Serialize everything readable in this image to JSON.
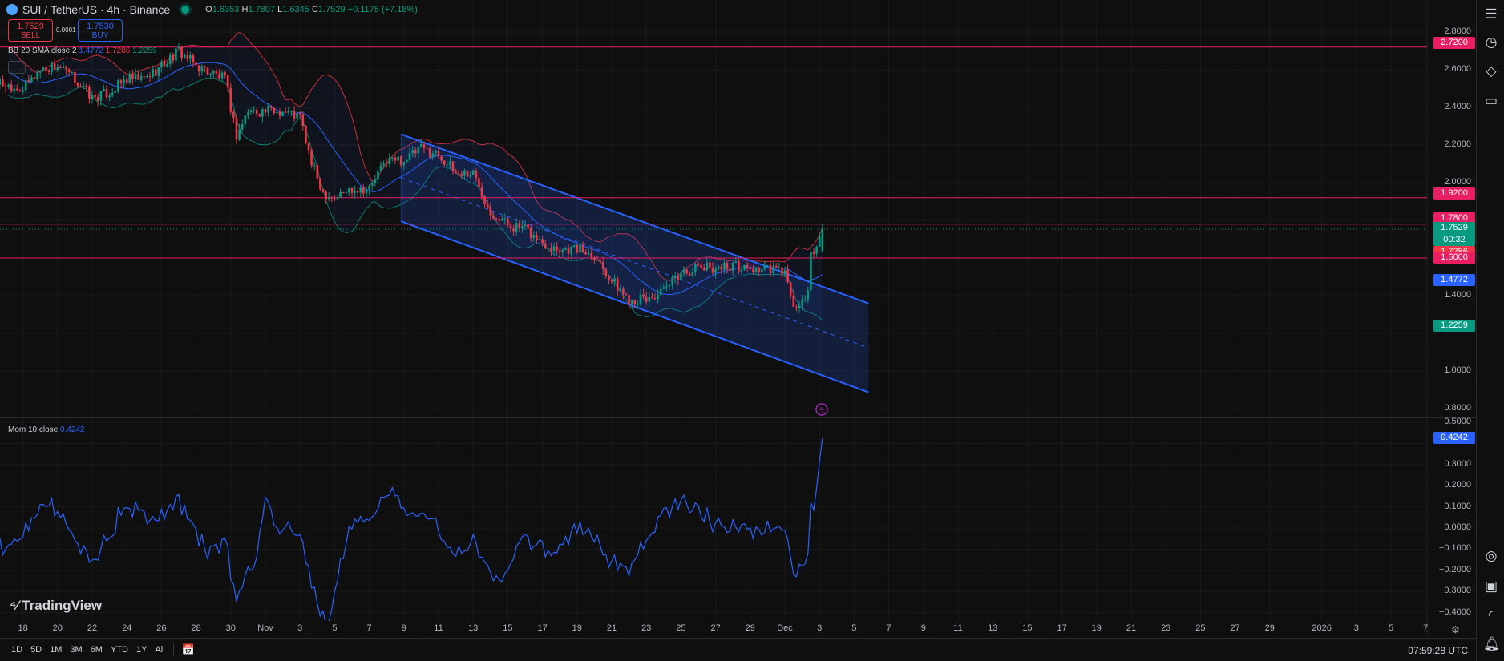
{
  "header": {
    "symbol": "SUI / TetherUS · 4h · Binance",
    "open_label": "O",
    "open": "1.6353",
    "high_label": "H",
    "high": "1.7807",
    "low_label": "L",
    "low": "1.6345",
    "close_label": "C",
    "close": "1.7529",
    "change": "+0.1175 (+7.18%)"
  },
  "trade": {
    "sell_price": "1.7529",
    "sell_label": "SELL",
    "spread": "0.0001",
    "buy_price": "1.7530",
    "buy_label": "BUY"
  },
  "bb_legend": {
    "name": "BB 20 SMA close 2",
    "basis": "1.4772",
    "upper": "1.7286",
    "lower": "1.2259"
  },
  "mom_legend": {
    "name": "Mom 10 close",
    "value": "0.4242"
  },
  "colors": {
    "up": "#089981",
    "down": "#f23645",
    "basis": "#2962ff",
    "upper": "#f23645",
    "lower": "#089981",
    "hline": "#e91e63",
    "channel": "#2962ff",
    "momentum": "#2962ff",
    "background": "#0f0f0f"
  },
  "price_axis": [
    "2.8000",
    "2.6000",
    "2.4000",
    "2.2000",
    "2.0000",
    "1.4000",
    "1.0000",
    "0.8000"
  ],
  "mom_axis": [
    "0.5000",
    "0.3000",
    "0.2000",
    "0.1000",
    "0.0000",
    "−0.1000",
    "−0.2000",
    "−0.3000",
    "−0.4000"
  ],
  "price_tags": [
    {
      "text": "2.7200",
      "color": "#e91e63"
    },
    {
      "text": "1.9200",
      "color": "#e91e63"
    },
    {
      "text": "1.7800",
      "color": "#e91e63"
    },
    {
      "text": "1.7529",
      "sub": "00:32",
      "color": "#089981"
    },
    {
      "text": "1.7286",
      "color": "#f23645"
    },
    {
      "text": "1.6000",
      "color": "#e91e63"
    },
    {
      "text": "1.4772",
      "color": "#2962ff"
    },
    {
      "text": "1.2259",
      "color": "#089981"
    }
  ],
  "mom_tag": {
    "text": "0.4242",
    "color": "#2962ff"
  },
  "time_ticks": [
    [
      "18",
      "2025-10-18"
    ],
    [
      "20",
      "2025-10-20"
    ],
    [
      "22",
      "2025-10-22"
    ],
    [
      "24",
      "2025-10-24"
    ],
    [
      "26",
      "2025-10-26"
    ],
    [
      "28",
      "2025-10-28"
    ],
    [
      "30",
      "2025-10-30"
    ],
    [
      "Nov",
      "2025-11-01"
    ],
    [
      "3",
      "2025-11-03"
    ],
    [
      "5",
      "2025-11-05"
    ],
    [
      "7",
      "2025-11-07"
    ],
    [
      "9",
      "2025-11-09"
    ],
    [
      "11",
      "2025-11-11"
    ],
    [
      "13",
      "2025-11-13"
    ],
    [
      "15",
      "2025-11-15"
    ],
    [
      "17",
      "2025-11-17"
    ],
    [
      "19",
      "2025-11-19"
    ],
    [
      "21",
      "2025-11-21"
    ],
    [
      "23",
      "2025-11-23"
    ],
    [
      "25",
      "2025-11-25"
    ],
    [
      "27",
      "2025-11-27"
    ],
    [
      "29",
      "2025-11-29"
    ],
    [
      "Dec",
      "2025-12-01"
    ],
    [
      "3",
      "2025-12-03"
    ],
    [
      "5",
      "2025-12-05"
    ],
    [
      "7",
      "2025-12-07"
    ],
    [
      "9",
      "2025-12-09"
    ],
    [
      "11",
      "2025-12-11"
    ],
    [
      "13",
      "2025-12-13"
    ],
    [
      "15",
      "2025-12-15"
    ],
    [
      "17",
      "2025-12-17"
    ],
    [
      "19",
      "2025-12-19"
    ],
    [
      "21",
      "2025-12-21"
    ],
    [
      "23",
      "2025-12-23"
    ],
    [
      "25",
      "2025-12-25"
    ],
    [
      "27",
      "2025-12-27"
    ],
    [
      "29",
      "2025-12-29"
    ],
    [
      "2026",
      "2026-01-01"
    ],
    [
      "3",
      "2026-01-03"
    ],
    [
      "5",
      "2026-01-05"
    ],
    [
      "7",
      "2026-01-07"
    ]
  ],
  "periods": [
    "1D",
    "5D",
    "1M",
    "3M",
    "6M",
    "YTD",
    "1Y",
    "All"
  ],
  "clock": "07:59:28 UTC",
  "logo": "TradingView",
  "right_toolbar": [
    "watchlist-icon",
    "alarm-clock-icon",
    "layers-icon",
    "chat-icon",
    "target-icon",
    "calendar-icon",
    "signal-icon",
    "bell-icon"
  ],
  "chart_data": {
    "type": "candlestick",
    "symbol": "SUI / TetherUS",
    "interval": "4h",
    "ylim": [
      0.8,
      2.8
    ],
    "horizontal_lines": [
      2.72,
      1.92,
      1.78,
      1.6
    ],
    "last_price": 1.7529,
    "channel": {
      "upper": [
        [
          "2025-11-08T20:00",
          2.257
        ],
        [
          "2025-12-05T20:00",
          1.359
        ]
      ],
      "lower": [
        [
          "2025-11-08T20:00",
          1.795
        ],
        [
          "2025-12-05T20:00",
          0.887
        ]
      ]
    },
    "bollinger": {
      "length": 20,
      "mult": 2,
      "basis": 1.4772,
      "upper": 1.7286,
      "lower": 1.2259
    },
    "momentum": {
      "length": 10,
      "last": 0.4242,
      "ylim": [
        -0.4,
        0.5
      ]
    },
    "approx_closes": [
      [
        "2025-10-14T00:00",
        2.7
      ],
      [
        "2025-10-15T00:00",
        2.62
      ],
      [
        "2025-10-16T00:00",
        2.55
      ],
      [
        "2025-10-17T00:00",
        2.52
      ],
      [
        "2025-10-18T00:00",
        2.5
      ],
      [
        "2025-10-19T00:00",
        2.6
      ],
      [
        "2025-10-20T00:00",
        2.62
      ],
      [
        "2025-10-21T00:00",
        2.55
      ],
      [
        "2025-10-22T00:00",
        2.45
      ],
      [
        "2025-10-23T00:00",
        2.48
      ],
      [
        "2025-10-24T00:00",
        2.55
      ],
      [
        "2025-10-25T00:00",
        2.55
      ],
      [
        "2025-10-26T00:00",
        2.62
      ],
      [
        "2025-10-27T00:00",
        2.7
      ],
      [
        "2025-10-28T00:00",
        2.62
      ],
      [
        "2025-10-29T00:00",
        2.58
      ],
      [
        "2025-10-29T16:00",
        2.55
      ],
      [
        "2025-10-30T08:00",
        2.25
      ],
      [
        "2025-10-31T00:00",
        2.38
      ],
      [
        "2025-11-01T00:00",
        2.38
      ],
      [
        "2025-11-02T00:00",
        2.38
      ],
      [
        "2025-11-03T00:00",
        2.35
      ],
      [
        "2025-11-03T16:00",
        2.1
      ],
      [
        "2025-11-04T08:00",
        1.95
      ],
      [
        "2025-11-05T00:00",
        1.92
      ],
      [
        "2025-11-06T00:00",
        1.97
      ],
      [
        "2025-11-07T00:00",
        1.97
      ],
      [
        "2025-11-08T00:00",
        2.12
      ],
      [
        "2025-11-09T00:00",
        2.12
      ],
      [
        "2025-11-10T00:00",
        2.18
      ],
      [
        "2025-11-11T00:00",
        2.15
      ],
      [
        "2025-11-12T00:00",
        2.05
      ],
      [
        "2025-11-13T00:00",
        2.05
      ],
      [
        "2025-11-14T00:00",
        1.85
      ],
      [
        "2025-11-15T00:00",
        1.78
      ],
      [
        "2025-11-16T00:00",
        1.75
      ],
      [
        "2025-11-17T00:00",
        1.68
      ],
      [
        "2025-11-18T00:00",
        1.65
      ],
      [
        "2025-11-19T00:00",
        1.65
      ],
      [
        "2025-11-20T00:00",
        1.62
      ],
      [
        "2025-11-21T00:00",
        1.48
      ],
      [
        "2025-11-22T00:00",
        1.38
      ],
      [
        "2025-11-23T00:00",
        1.38
      ],
      [
        "2025-11-24T00:00",
        1.42
      ],
      [
        "2025-11-25T00:00",
        1.52
      ],
      [
        "2025-11-26T00:00",
        1.55
      ],
      [
        "2025-11-27T00:00",
        1.55
      ],
      [
        "2025-11-28T00:00",
        1.56
      ],
      [
        "2025-11-29T00:00",
        1.54
      ],
      [
        "2025-11-30T00:00",
        1.54
      ],
      [
        "2025-12-01T00:00",
        1.53
      ],
      [
        "2025-12-01T08:00",
        1.38
      ],
      [
        "2025-12-01T16:00",
        1.33
      ],
      [
        "2025-12-02T00:00",
        1.36
      ],
      [
        "2025-12-02T08:00",
        1.4
      ],
      [
        "2025-12-02T12:00",
        1.62
      ],
      [
        "2025-12-02T20:00",
        1.66
      ],
      [
        "2025-12-03T04:00",
        1.7529
      ]
    ]
  }
}
